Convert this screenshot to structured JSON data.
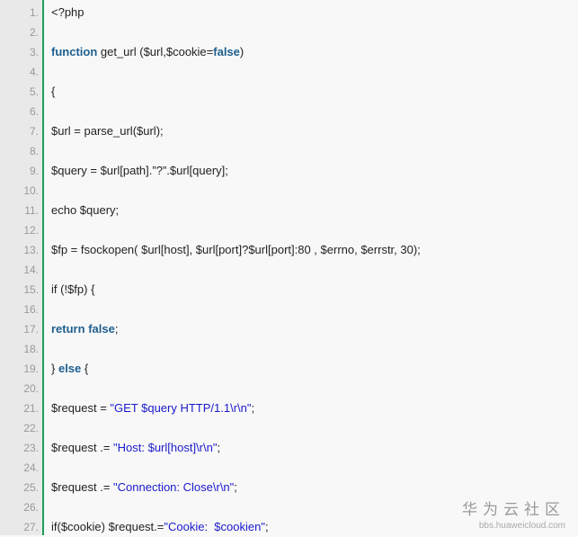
{
  "lines": [
    [
      {
        "t": "<?php",
        "c": ""
      }
    ],
    [],
    [
      {
        "t": "function",
        "c": "kw"
      },
      {
        "t": " get_url ($url,$cookie=",
        "c": ""
      },
      {
        "t": "false",
        "c": "kw"
      },
      {
        "t": ")",
        "c": ""
      }
    ],
    [],
    [
      {
        "t": "{",
        "c": ""
      }
    ],
    [],
    [
      {
        "t": "$url = parse_url($url);",
        "c": ""
      }
    ],
    [],
    [
      {
        "t": "$query = $url[path].”?”.$url[query];",
        "c": ""
      }
    ],
    [],
    [
      {
        "t": "echo $query;",
        "c": ""
      }
    ],
    [],
    [
      {
        "t": "$fp = fsockopen( $url[host], $url[port]?$url[port]:80 , $errno, $errstr, 30);",
        "c": ""
      }
    ],
    [],
    [
      {
        "t": "if (!$fp) {",
        "c": ""
      }
    ],
    [],
    [
      {
        "t": "return",
        "c": "kw"
      },
      {
        "t": " ",
        "c": ""
      },
      {
        "t": "false",
        "c": "kw"
      },
      {
        "t": ";",
        "c": ""
      }
    ],
    [],
    [
      {
        "t": "} ",
        "c": ""
      },
      {
        "t": "else",
        "c": "kw"
      },
      {
        "t": " {",
        "c": ""
      }
    ],
    [],
    [
      {
        "t": "$request = ",
        "c": ""
      },
      {
        "t": "\"GET $query HTTP/1.1\\r\\n\"",
        "c": "str"
      },
      {
        "t": ";",
        "c": ""
      }
    ],
    [],
    [
      {
        "t": "$request .= ",
        "c": ""
      },
      {
        "t": "\"Host: $url[host]\\r\\n\"",
        "c": "str"
      },
      {
        "t": ";",
        "c": ""
      }
    ],
    [],
    [
      {
        "t": "$request .= ",
        "c": ""
      },
      {
        "t": "\"Connection: Close\\r\\n\"",
        "c": "str"
      },
      {
        "t": ";",
        "c": ""
      }
    ],
    [],
    [
      {
        "t": "if($cookie) $request.=",
        "c": ""
      },
      {
        "t": "\"Cookie:  $cookien\"",
        "c": "str"
      },
      {
        "t": ";",
        "c": ""
      }
    ]
  ],
  "watermark": {
    "title": "华为云社区",
    "url": "bbs.huaweicloud.com"
  }
}
